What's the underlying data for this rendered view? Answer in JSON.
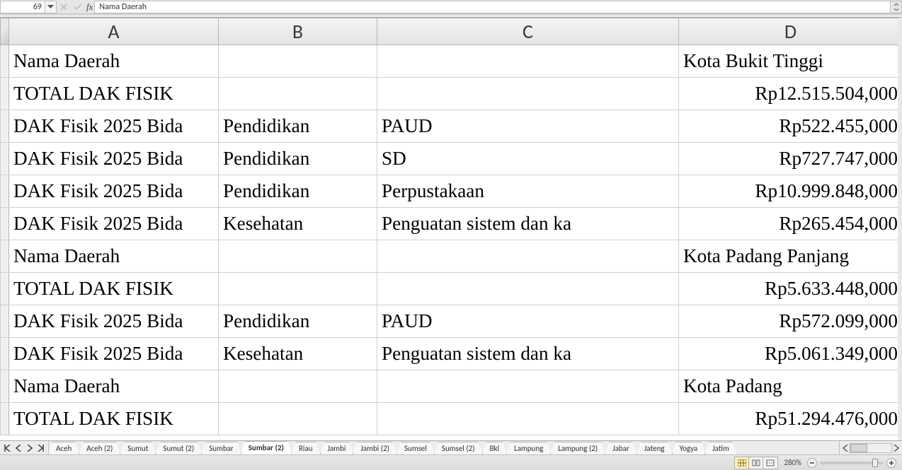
{
  "formula_bar": {
    "name_box": "69",
    "fx_label": "fx",
    "formula": "Nama Daerah"
  },
  "columns": [
    "A",
    "B",
    "C",
    "D"
  ],
  "selected_column_index": 0,
  "rows": [
    {
      "A": "Nama Daerah",
      "B": "",
      "C": "",
      "D": "Kota Bukit Tinggi",
      "D_align": "left"
    },
    {
      "A": "TOTAL DAK FISIK",
      "B": "",
      "C": "",
      "D": "Rp12.515.504,000"
    },
    {
      "A": "DAK Fisik 2025 Bida",
      "B": "Pendidikan",
      "C": "PAUD",
      "D": "Rp522.455,000"
    },
    {
      "A": "DAK Fisik 2025 Bida",
      "B": "Pendidikan",
      "C": "SD",
      "D": "Rp727.747,000"
    },
    {
      "A": "DAK Fisik 2025 Bida",
      "B": "Pendidikan",
      "C": "Perpustakaan",
      "D": "Rp10.999.848,000"
    },
    {
      "A": "DAK Fisik 2025 Bida",
      "B": "Kesehatan",
      "C": "Penguatan sistem dan ka",
      "D": "Rp265.454,000"
    },
    {
      "A": "Nama Daerah",
      "B": "",
      "C": "",
      "D": "Kota Padang Panjang",
      "D_align": "left"
    },
    {
      "A": "TOTAL DAK FISIK",
      "B": "",
      "C": "",
      "D": "Rp5.633.448,000"
    },
    {
      "A": "DAK Fisik 2025 Bida",
      "B": "Pendidikan",
      "C": "PAUD",
      "D": "Rp572.099,000"
    },
    {
      "A": "DAK Fisik 2025 Bida",
      "B": "Kesehatan",
      "C": "Penguatan sistem dan ka",
      "D": "Rp5.061.349,000"
    },
    {
      "A": "Nama Daerah",
      "B": "",
      "C": "",
      "D": "Kota Padang",
      "D_align": "left"
    },
    {
      "A": "TOTAL DAK FISIK",
      "B": "",
      "C": "",
      "D": "Rp51.294.476,000"
    }
  ],
  "sheet_tabs": [
    {
      "label": "Aceh",
      "active": false
    },
    {
      "label": "Aceh (2)",
      "active": false
    },
    {
      "label": "Sumut",
      "active": false
    },
    {
      "label": "Sumut (2)",
      "active": false
    },
    {
      "label": "Sumbar",
      "active": false
    },
    {
      "label": "Sumbar (2)",
      "active": true
    },
    {
      "label": "Riau",
      "active": false
    },
    {
      "label": "Jambi",
      "active": false
    },
    {
      "label": "Jambi (2)",
      "active": false
    },
    {
      "label": "Sumsel",
      "active": false
    },
    {
      "label": "Sumsel (2)",
      "active": false
    },
    {
      "label": "Bkl",
      "active": false
    },
    {
      "label": "Lampung",
      "active": false
    },
    {
      "label": "Lampung (2)",
      "active": false
    },
    {
      "label": "Jabar",
      "active": false
    },
    {
      "label": "Jateng",
      "active": false
    },
    {
      "label": "Yogya",
      "active": false
    },
    {
      "label": "Jatim",
      "active": false
    }
  ],
  "status": {
    "zoom_label": "280%",
    "zoom_thumb_left_pct": 82
  },
  "icons": {
    "dropdown": "chevron-down-icon",
    "cancel": "cancel-icon",
    "confirm": "check-icon",
    "expand": "expand-icon"
  }
}
